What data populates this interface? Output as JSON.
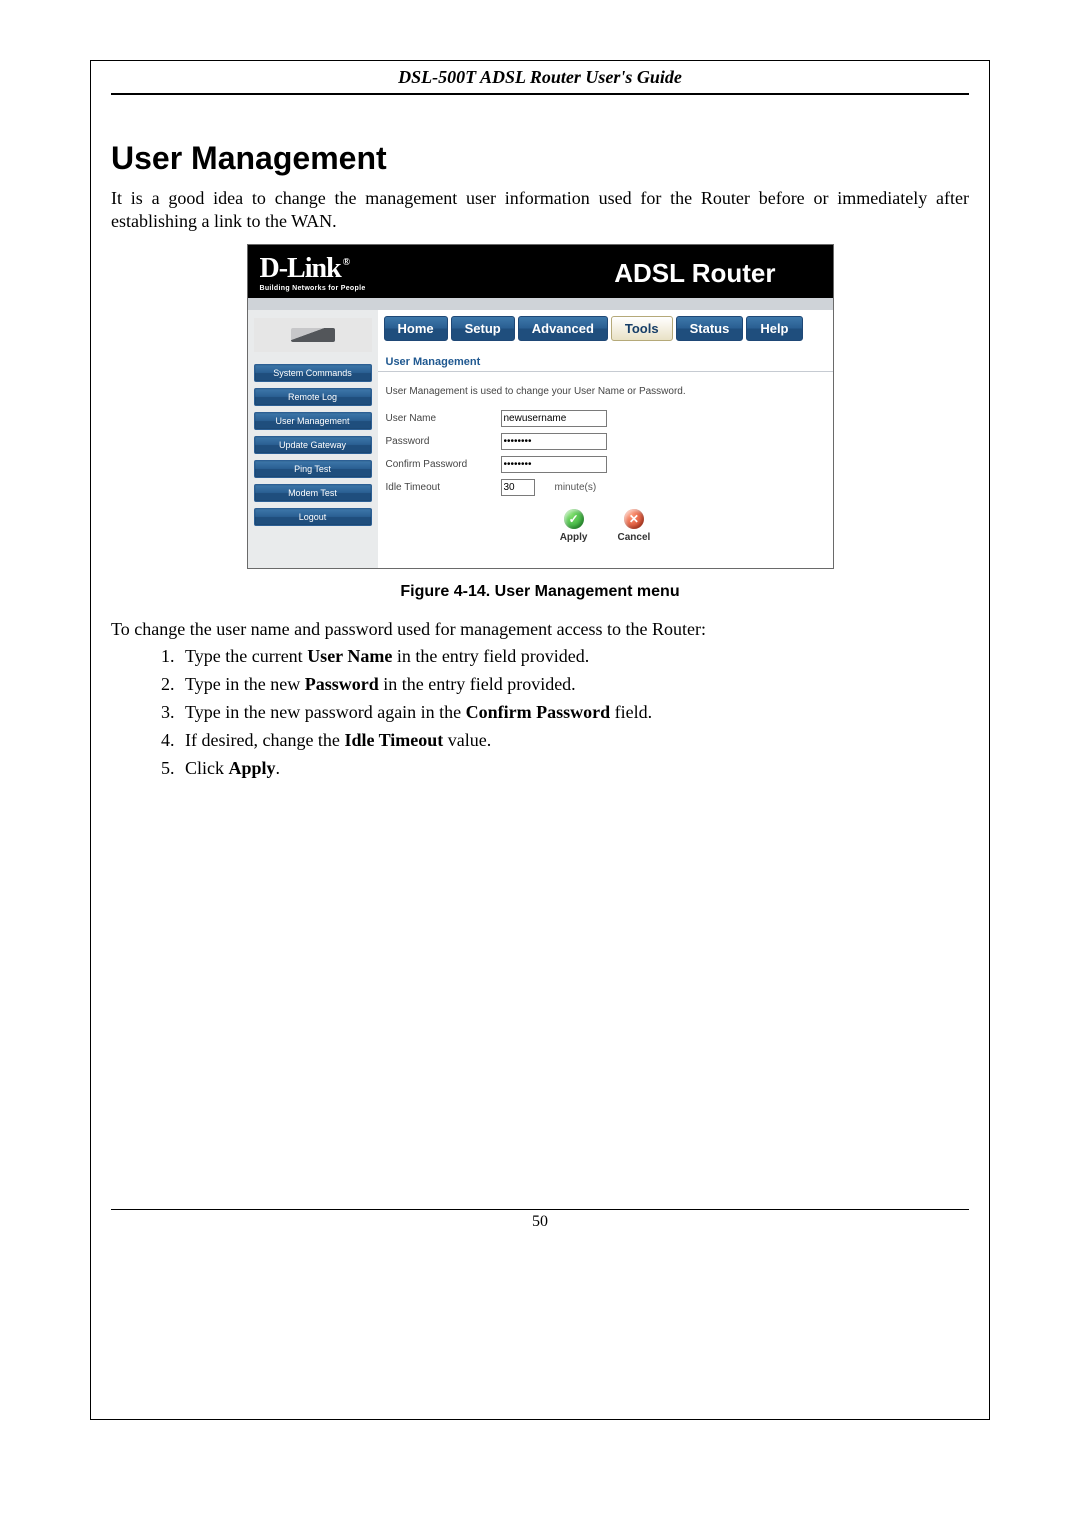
{
  "doc": {
    "header": "DSL-500T ADSL Router User's Guide",
    "section_title": "User Management",
    "intro": "It is a good idea to change the management user information used for the Router before or immediately after establishing a link to the WAN.",
    "caption": "Figure 4-14. User Management menu",
    "followup": "To change the user name and password used for management access to the Router:",
    "steps": {
      "s1_a": "Type the current ",
      "s1_b": "User Name",
      "s1_c": " in the entry field provided.",
      "s2_a": "Type in the new ",
      "s2_b": "Password",
      "s2_c": " in the entry field provided.",
      "s3_a": "Type in the new password again in the ",
      "s3_b": "Confirm Password",
      "s3_c": " field.",
      "s4_a": "If desired, change the ",
      "s4_b": "Idle Timeout",
      "s4_c": " value.",
      "s5_a": "Click ",
      "s5_b": "Apply",
      "s5_c": "."
    },
    "page_number": "50"
  },
  "router": {
    "brand_logo": "D-Link",
    "brand_tagline": "Building Networks for People",
    "product_title": "ADSL Router",
    "tabs": {
      "home": "Home",
      "setup": "Setup",
      "advanced": "Advanced",
      "tools": "Tools",
      "status": "Status",
      "help": "Help"
    },
    "side": {
      "system_commands": "System Commands",
      "remote_log": "Remote Log",
      "user_management": "User Management",
      "update_gateway": "Update Gateway",
      "ping_test": "Ping Test",
      "modem_test": "Modem Test",
      "logout": "Logout"
    },
    "panel": {
      "heading": "User Management",
      "description": "User Management is used to change your User Name or Password.",
      "user_name_label": "User Name",
      "user_name_value": "newusername",
      "password_label": "Password",
      "password_value": "••••••••",
      "confirm_password_label": "Confirm Password",
      "confirm_password_value": "••••••••",
      "idle_timeout_label": "Idle Timeout",
      "idle_timeout_value": "30",
      "idle_timeout_units": "minute(s)",
      "apply_label": "Apply",
      "cancel_label": "Cancel",
      "apply_glyph": "✓",
      "cancel_glyph": "✕"
    }
  }
}
